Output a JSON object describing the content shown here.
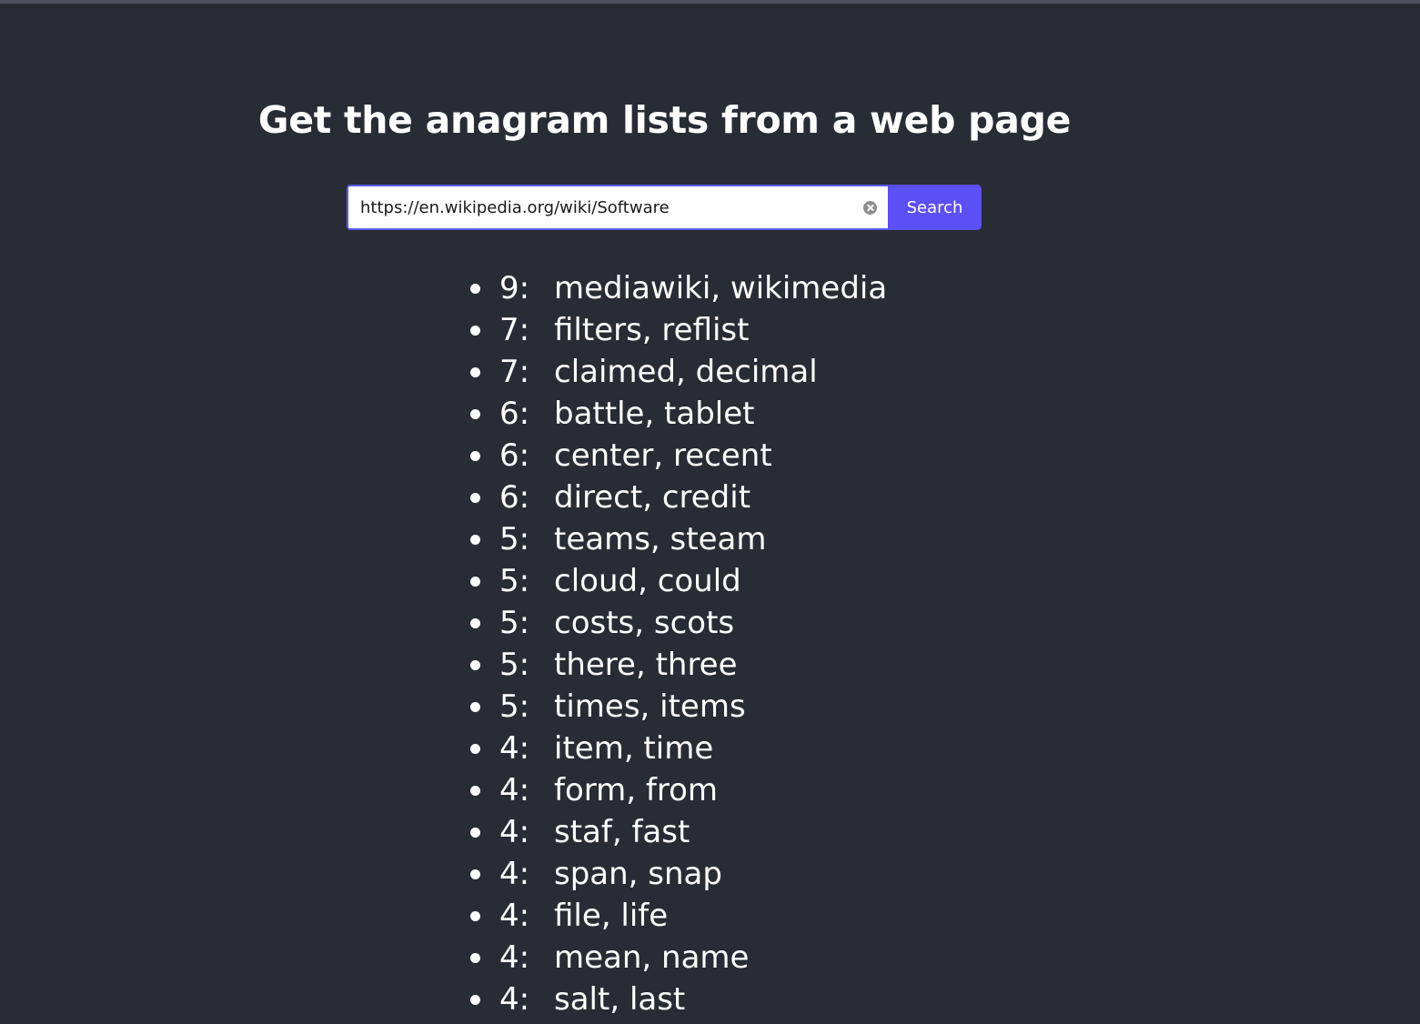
{
  "page": {
    "title": "Get the anagram lists from a web page"
  },
  "search": {
    "value": "https://en.wikipedia.org/wiki/Software",
    "button_label": "Search",
    "clear_icon": "clear-circle-x-icon"
  },
  "colors": {
    "background": "#282c35",
    "accent": "#5b4ff6",
    "text": "#ffffff"
  },
  "results": [
    {
      "count": "9:",
      "words": "mediawiki, wikimedia"
    },
    {
      "count": "7:",
      "words": "filters, reflist"
    },
    {
      "count": "7:",
      "words": "claimed, decimal"
    },
    {
      "count": "6:",
      "words": "battle, tablet"
    },
    {
      "count": "6:",
      "words": "center, recent"
    },
    {
      "count": "6:",
      "words": "direct, credit"
    },
    {
      "count": "5:",
      "words": "teams, steam"
    },
    {
      "count": "5:",
      "words": "cloud, could"
    },
    {
      "count": "5:",
      "words": "costs, scots"
    },
    {
      "count": "5:",
      "words": "there, three"
    },
    {
      "count": "5:",
      "words": "times, items"
    },
    {
      "count": "4:",
      "words": "item, time"
    },
    {
      "count": "4:",
      "words": "form, from"
    },
    {
      "count": "4:",
      "words": "staf, fast"
    },
    {
      "count": "4:",
      "words": "span, snap"
    },
    {
      "count": "4:",
      "words": "file, life"
    },
    {
      "count": "4:",
      "words": "mean, name"
    },
    {
      "count": "4:",
      "words": "salt, last"
    }
  ]
}
